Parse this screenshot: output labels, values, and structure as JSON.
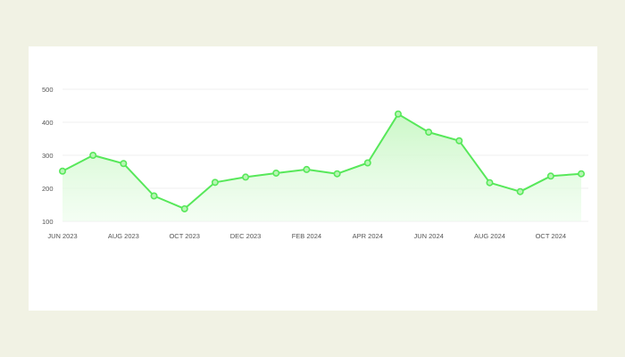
{
  "chart_data": {
    "type": "area",
    "title": "",
    "xlabel": "",
    "ylabel": "",
    "ylim": [
      100,
      500
    ],
    "yticks": [
      100,
      200,
      300,
      400,
      500
    ],
    "grid": true,
    "legend": "none",
    "x": [
      "2023-06",
      "2023-07",
      "2023-08",
      "2023-09",
      "2023-10",
      "2023-11",
      "2023-12",
      "2024-01",
      "2024-02",
      "2024-03",
      "2024-04",
      "2024-05",
      "2024-06",
      "2024-07",
      "2024-08",
      "2024-09",
      "2024-10",
      "2024-11"
    ],
    "xtick_labels": [
      {
        "month": "2023-06",
        "label": "JUN 2023"
      },
      {
        "month": "2023-08",
        "label": "AUG 2023"
      },
      {
        "month": "2023-10",
        "label": "OCT 2023"
      },
      {
        "month": "2023-12",
        "label": "DEC 2023"
      },
      {
        "month": "2024-02",
        "label": "FEB 2024"
      },
      {
        "month": "2024-04",
        "label": "APR 2024"
      },
      {
        "month": "2024-06",
        "label": "JUN 2024"
      },
      {
        "month": "2024-08",
        "label": "AUG 2024"
      },
      {
        "month": "2024-10",
        "label": "OCT 2024"
      }
    ],
    "series": [
      {
        "values": [
          252,
          300,
          275,
          177,
          138,
          218,
          234,
          246,
          257,
          244,
          277,
          425,
          370,
          344,
          217,
          190,
          237,
          244
        ]
      }
    ],
    "colors": {
      "line": "#57e85a",
      "marker_fill": "#b8f5b4",
      "area_top": "#c8f7c4",
      "area_bottom": "#ecfdeb",
      "grid": "#efefef",
      "axis_text": "#555555"
    }
  }
}
